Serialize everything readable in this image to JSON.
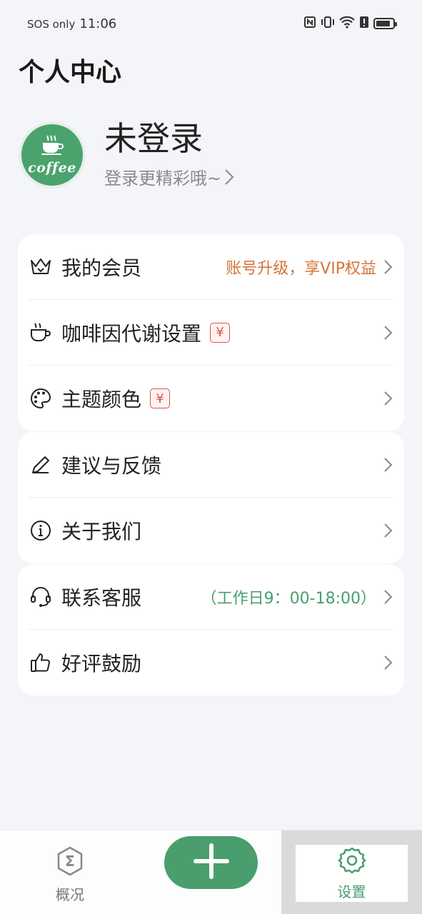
{
  "status_bar": {
    "carrier": "SOS only",
    "time": "11:06",
    "icons": [
      "nfc-icon",
      "vibrate-icon",
      "wifi-icon",
      "alert-icon",
      "battery-icon"
    ],
    "battery_level": 0.85
  },
  "header": {
    "title": "个人中心"
  },
  "profile": {
    "avatar_text": "coffee",
    "name": "未登录",
    "subtitle": "登录更精彩哦~"
  },
  "menu_groups": [
    {
      "items": [
        {
          "label": "我的会员",
          "icon": "crown-icon",
          "extra": "账号升级，享VIP权益"
        },
        {
          "label": "咖啡因代谢设置",
          "icon": "coffee-cup-icon",
          "badge": "Y"
        },
        {
          "label": "主题颜色",
          "icon": "palette-icon",
          "badge": "Y"
        }
      ]
    },
    {
      "items": [
        {
          "label": "建议与反馈",
          "icon": "pencil-icon"
        },
        {
          "label": "关于我们",
          "icon": "info-icon"
        }
      ]
    },
    {
      "items": [
        {
          "label": "联系客服",
          "icon": "headset-icon",
          "extra": "（工作日9：00-18:00）"
        },
        {
          "label": "好评鼓励",
          "icon": "thumbs-up-icon"
        }
      ]
    }
  ],
  "tabbar": {
    "overview_label": "概况",
    "overview_icon_glyph": "Σ",
    "settings_label": "设置",
    "accent_color": "#4a9e6e",
    "vip_color": "#d9534f"
  }
}
